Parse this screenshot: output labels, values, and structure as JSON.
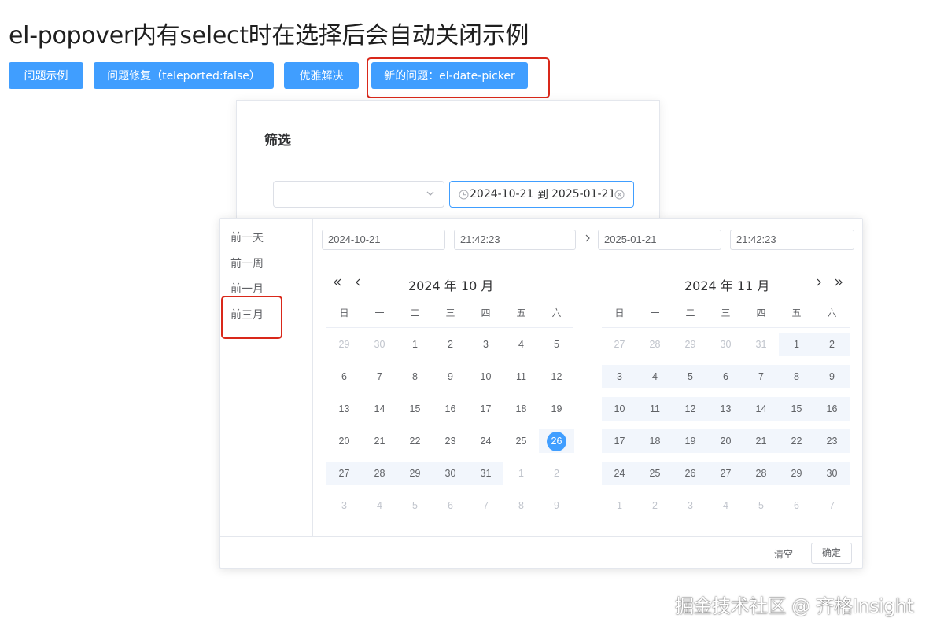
{
  "page_title": "el-popover内有select时在选择后会自动关闭示例",
  "buttons": [
    "问题示例",
    "问题修复（teleported:false）",
    "优雅解决",
    "新的问题：el-date-picker"
  ],
  "popover": {
    "title": "筛选",
    "select_value": "",
    "range_start": "2024-10-21",
    "range_separator": "到",
    "range_end": "2025-01-21"
  },
  "picker": {
    "shortcuts": [
      "前一天",
      "前一周",
      "前一月",
      "前三月"
    ],
    "start_date": "2024-10-21",
    "start_time": "21:42:23",
    "end_date": "2025-01-21",
    "end_time": "21:42:23",
    "weekdays": [
      "日",
      "一",
      "二",
      "三",
      "四",
      "五",
      "六"
    ],
    "left_header": "2024 年 10 月",
    "right_header": "2024 年 11 月",
    "left_days": [
      29,
      30,
      1,
      2,
      3,
      4,
      5,
      6,
      7,
      8,
      9,
      10,
      11,
      12,
      13,
      14,
      15,
      16,
      17,
      18,
      19,
      20,
      21,
      22,
      23,
      24,
      25,
      26,
      27,
      28,
      29,
      30,
      31,
      1,
      2,
      3,
      4,
      5,
      6,
      7,
      8,
      9
    ],
    "right_days": [
      27,
      28,
      29,
      30,
      31,
      1,
      2,
      3,
      4,
      5,
      6,
      7,
      8,
      9,
      10,
      11,
      12,
      13,
      14,
      15,
      16,
      17,
      18,
      19,
      20,
      21,
      22,
      23,
      24,
      25,
      26,
      27,
      28,
      29,
      30,
      1,
      2,
      3,
      4,
      5,
      6,
      7
    ],
    "footer_clear": "清空",
    "footer_ok": "确定"
  },
  "watermark": "掘金技术社区 @ 齐格Insight",
  "colors": {
    "primary": "#409eff",
    "highlight": "#d9281a",
    "range_bg": "#f2f6fc"
  }
}
